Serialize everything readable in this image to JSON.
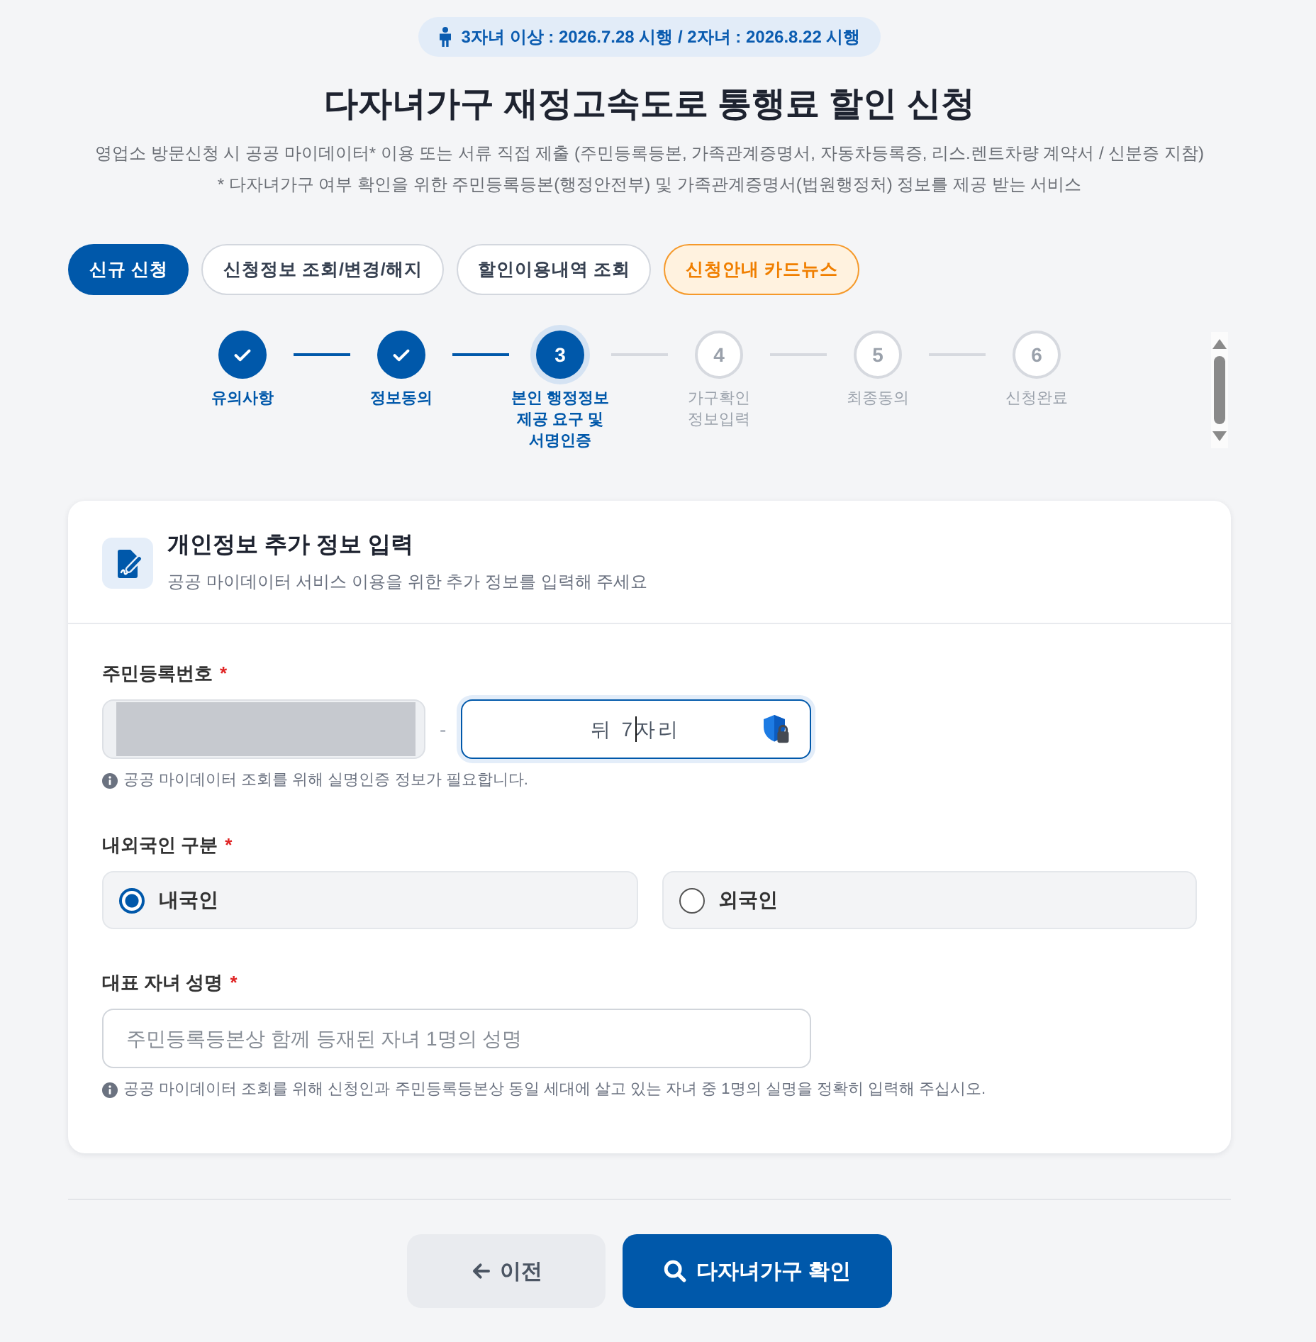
{
  "notice": {
    "text": "3자녀 이상 : 2026.7.28 시행 / 2자녀 : 2026.8.22 시행"
  },
  "header": {
    "title": "다자녀가구 재정고속도로 통행료 할인 신청",
    "description": [
      "영업소 방문신청 시 공공 마이데이터* 이용 또는 서류 직접 제출 (주민등록등본, 가족관계증명서, 자동차등록증, 리스.렌트차량 계약서 / 신분증 지참)",
      "* 다자녀가구 여부 확인을 위한 주민등록등본(행정안전부) 및 가족관계증명서(법원행정처) 정보를 제공 받는 서비스"
    ]
  },
  "tabs": [
    {
      "label": "신규 신청",
      "selected": true,
      "kind": "menu"
    },
    {
      "label": "신청정보 조회/변경/해지",
      "selected": false,
      "kind": "menu"
    },
    {
      "label": "할인이용내역 조회",
      "selected": false,
      "kind": "menu"
    },
    {
      "label": "신청안내 카드뉴스",
      "selected": false,
      "kind": "promo"
    }
  ],
  "stepper": {
    "steps": [
      {
        "label": "유의사항",
        "completed": true,
        "current": false
      },
      {
        "label": "정보동의",
        "completed": true,
        "current": false
      },
      {
        "number": "3",
        "label": "본인 행정정보 제공 요구 및 서명인증",
        "completed": false,
        "current": true
      },
      {
        "number": "4",
        "label": "가구확인 정보입력",
        "completed": false,
        "current": false
      },
      {
        "number": "5",
        "label": "최종동의",
        "completed": false,
        "current": false
      },
      {
        "number": "6",
        "label": "신청완료",
        "completed": false,
        "current": false
      }
    ]
  },
  "form": {
    "title": "개인정보 추가 정보 입력",
    "subtitle": "공공 마이데이터 서비스 이용을 위한 추가 정보를 입력해 주세요",
    "fields": [
      {
        "kind": "split",
        "label": "주민등록번호",
        "required_mark": "*",
        "front": {
          "masked": true
        },
        "separator": "-",
        "back": {
          "placeholder": "뒤 7자리",
          "focused": true
        },
        "hint": "공공 마이데이터 조회를 위해 실명인증 정보가 필요합니다."
      },
      {
        "kind": "radio",
        "label": "내외국인 구분",
        "required_mark": "*",
        "options": [
          {
            "label": "내국인",
            "selected": true
          },
          {
            "label": "외국인",
            "selected": false
          }
        ]
      },
      {
        "kind": "text",
        "label": "대표 자녀 성명",
        "required_mark": "*",
        "placeholder": "주민등록등본상 함께 등재된 자녀 1명의 성명",
        "hint": "공공 마이데이터 조회를 위해 신청인과 주민등록등본상 동일 세대에 살고 있는 자녀 중 1명의 실명을 정확히 입력해 주십시오."
      }
    ]
  },
  "actions": [
    {
      "kind": "back",
      "label": "이전"
    },
    {
      "kind": "search",
      "label": "다자녀가구 확인"
    }
  ]
}
